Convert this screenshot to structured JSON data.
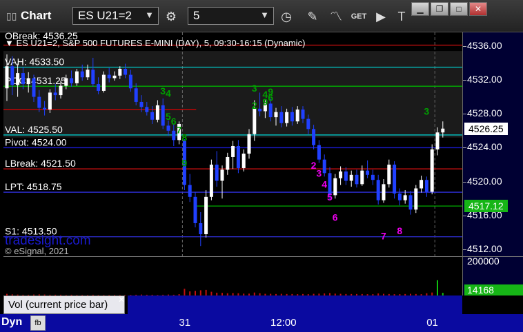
{
  "window": {
    "title": "Chart",
    "symbol": "ES U21=2",
    "interval": "5",
    "controls": [
      "minimize",
      "restore",
      "maximize",
      "close"
    ]
  },
  "toolbar_icons": [
    "gear-icon",
    "clock-icon",
    "pencil-icon",
    "line-tool-icon",
    "get-icon",
    "play-icon",
    "text-tool-icon"
  ],
  "header": {
    "top_label": "OBreak: 4536.25",
    "description": "ES U21=2, S&P 500 FUTURES E-MINI (DAY), 5, 09:30-16:15 (Dynamic)"
  },
  "levels": [
    {
      "name": "VAH",
      "label": "VAH: 4533.50",
      "value": 4533.5,
      "color": "#00c8c8",
      "x_from": 0
    },
    {
      "name": "POC",
      "label": "POC: 4531.25",
      "value": 4531.25,
      "color": "#00b000",
      "x_from": 0
    },
    {
      "name": "Red line",
      "label": "",
      "value": 4528.5,
      "color": "#e00000",
      "x_from": 0,
      "x_to": 0.42
    },
    {
      "name": "VAL",
      "label": "VAL: 4525.50",
      "value": 4525.5,
      "color": "#00c8c8",
      "x_from": 0
    },
    {
      "name": "Pivot",
      "label": "Pivot: 4524.00",
      "value": 4524.0,
      "color": "#1a1acc",
      "x_from": 0
    },
    {
      "name": "LBreak",
      "label": "LBreak: 4521.50",
      "value": 4521.5,
      "color": "#d01010",
      "x_from": 0
    },
    {
      "name": "LPT",
      "label": "LPT: 4518.75",
      "value": 4518.75,
      "color": "#3030e0",
      "x_from": 0
    },
    {
      "name": "Green low",
      "label": "",
      "value": 4517.12,
      "color": "#00b000",
      "x_from": 0.42
    },
    {
      "name": "S1",
      "label": "S1: 4513.50",
      "value": 4513.5,
      "color": "#2a2ac0",
      "x_from": 0
    },
    {
      "name": "Upper red",
      "label": "",
      "value": 4536.1,
      "color": "#d01010",
      "x_from": 0
    }
  ],
  "watermarks": {
    "brand": "tradesight.com",
    "copyright": "© eSignal, 2021"
  },
  "chart_data": {
    "type": "candlestick",
    "ylim": [
      4511.2,
      4537.6
    ],
    "yticks": [
      4512,
      4516,
      4520,
      4524,
      4528,
      4532,
      4536
    ],
    "ytick_labels": [
      "4512.00",
      "4516.00",
      "4520.00",
      "4524.00",
      "4528.00",
      "4532.00",
      "4536.00"
    ],
    "last_price": "4526.25",
    "lpt_price": "4517.12",
    "x_labels": [
      {
        "text": "31",
        "index": 33
      },
      {
        "text": "12:00",
        "index": 50
      },
      {
        "text": "01",
        "index": 79
      }
    ],
    "candles": [
      {
        "o": 4531.0,
        "h": 4535.0,
        "l": 4529.5,
        "c": 4533.6
      },
      {
        "o": 4533.6,
        "h": 4534.8,
        "l": 4530.2,
        "c": 4531.4
      },
      {
        "o": 4531.4,
        "h": 4533.9,
        "l": 4530.0,
        "c": 4532.8
      },
      {
        "o": 4532.8,
        "h": 4533.5,
        "l": 4530.9,
        "c": 4531.5
      },
      {
        "o": 4531.5,
        "h": 4532.9,
        "l": 4530.5,
        "c": 4532.2
      },
      {
        "o": 4532.2,
        "h": 4532.6,
        "l": 4529.4,
        "c": 4530.0
      },
      {
        "o": 4530.0,
        "h": 4530.8,
        "l": 4528.2,
        "c": 4528.7
      },
      {
        "o": 4528.7,
        "h": 4529.5,
        "l": 4527.8,
        "c": 4528.5
      },
      {
        "o": 4528.5,
        "h": 4530.9,
        "l": 4528.1,
        "c": 4530.5
      },
      {
        "o": 4530.5,
        "h": 4531.5,
        "l": 4529.6,
        "c": 4530.2
      },
      {
        "o": 4530.2,
        "h": 4531.9,
        "l": 4529.8,
        "c": 4531.3
      },
      {
        "o": 4531.3,
        "h": 4532.6,
        "l": 4530.9,
        "c": 4532.2
      },
      {
        "o": 4532.2,
        "h": 4533.1,
        "l": 4531.2,
        "c": 4531.6
      },
      {
        "o": 4531.6,
        "h": 4533.3,
        "l": 4531.3,
        "c": 4533.0
      },
      {
        "o": 4533.0,
        "h": 4533.8,
        "l": 4531.9,
        "c": 4532.3
      },
      {
        "o": 4532.3,
        "h": 4533.8,
        "l": 4532.0,
        "c": 4533.2
      },
      {
        "o": 4533.2,
        "h": 4534.6,
        "l": 4531.2,
        "c": 4531.5
      },
      {
        "o": 4531.5,
        "h": 4532.3,
        "l": 4530.3,
        "c": 4530.7
      },
      {
        "o": 4530.7,
        "h": 4533.0,
        "l": 4530.5,
        "c": 4532.6
      },
      {
        "o": 4532.6,
        "h": 4533.4,
        "l": 4531.7,
        "c": 4532.2
      },
      {
        "o": 4532.2,
        "h": 4533.0,
        "l": 4531.9,
        "c": 4532.5
      },
      {
        "o": 4532.5,
        "h": 4533.6,
        "l": 4532.1,
        "c": 4533.3
      },
      {
        "o": 4533.3,
        "h": 4533.9,
        "l": 4532.2,
        "c": 4532.6
      },
      {
        "o": 4532.6,
        "h": 4533.2,
        "l": 4530.6,
        "c": 4531.0
      },
      {
        "o": 4531.0,
        "h": 4531.6,
        "l": 4529.0,
        "c": 4529.4
      },
      {
        "o": 4529.4,
        "h": 4530.2,
        "l": 4528.2,
        "c": 4528.8
      },
      {
        "o": 4528.8,
        "h": 4529.4,
        "l": 4527.8,
        "c": 4528.2
      },
      {
        "o": 4528.2,
        "h": 4528.9,
        "l": 4526.8,
        "c": 4527.3
      },
      {
        "o": 4527.3,
        "h": 4529.6,
        "l": 4527.0,
        "c": 4529.0
      },
      {
        "o": 4529.0,
        "h": 4529.8,
        "l": 4526.2,
        "c": 4526.6
      },
      {
        "o": 4526.6,
        "h": 4527.2,
        "l": 4525.4,
        "c": 4526.0
      },
      {
        "o": 4526.0,
        "h": 4526.8,
        "l": 4524.2,
        "c": 4524.9
      },
      {
        "o": 4524.9,
        "h": 4527.1,
        "l": 4524.4,
        "c": 4526.8
      },
      {
        "o": 4524.8,
        "h": 4525.0,
        "l": 4519.0,
        "c": 4519.6
      },
      {
        "o": 4519.6,
        "h": 4520.9,
        "l": 4517.6,
        "c": 4518.2
      },
      {
        "o": 4518.2,
        "h": 4518.8,
        "l": 4514.6,
        "c": 4515.1
      },
      {
        "o": 4515.1,
        "h": 4516.4,
        "l": 4512.4,
        "c": 4513.8
      },
      {
        "o": 4513.8,
        "h": 4519.0,
        "l": 4513.4,
        "c": 4518.2
      },
      {
        "o": 4518.2,
        "h": 4522.6,
        "l": 4517.8,
        "c": 4522.0
      },
      {
        "o": 4522.0,
        "h": 4523.6,
        "l": 4519.4,
        "c": 4520.1
      },
      {
        "o": 4520.1,
        "h": 4521.9,
        "l": 4518.0,
        "c": 4521.4
      },
      {
        "o": 4521.4,
        "h": 4523.4,
        "l": 4520.8,
        "c": 4522.9
      },
      {
        "o": 4522.9,
        "h": 4524.8,
        "l": 4521.5,
        "c": 4524.2
      },
      {
        "o": 4524.2,
        "h": 4524.9,
        "l": 4521.0,
        "c": 4521.6
      },
      {
        "o": 4521.6,
        "h": 4523.8,
        "l": 4521.2,
        "c": 4523.3
      },
      {
        "o": 4523.3,
        "h": 4526.2,
        "l": 4522.7,
        "c": 4525.6
      },
      {
        "o": 4525.6,
        "h": 4529.6,
        "l": 4524.8,
        "c": 4528.6
      },
      {
        "o": 4528.6,
        "h": 4530.5,
        "l": 4527.7,
        "c": 4528.3
      },
      {
        "o": 4528.3,
        "h": 4529.6,
        "l": 4527.5,
        "c": 4529.2
      },
      {
        "o": 4529.2,
        "h": 4529.8,
        "l": 4527.1,
        "c": 4527.6
      },
      {
        "o": 4527.6,
        "h": 4528.7,
        "l": 4526.6,
        "c": 4528.2
      },
      {
        "o": 4528.2,
        "h": 4528.9,
        "l": 4526.4,
        "c": 4526.9
      },
      {
        "o": 4526.9,
        "h": 4528.6,
        "l": 4526.5,
        "c": 4528.2
      },
      {
        "o": 4528.2,
        "h": 4528.8,
        "l": 4526.6,
        "c": 4527.1
      },
      {
        "o": 4527.1,
        "h": 4528.9,
        "l": 4526.8,
        "c": 4528.5
      },
      {
        "o": 4528.5,
        "h": 4528.9,
        "l": 4526.9,
        "c": 4527.4
      },
      {
        "o": 4527.4,
        "h": 4527.9,
        "l": 4525.6,
        "c": 4526.2
      },
      {
        "o": 4526.2,
        "h": 4526.7,
        "l": 4523.8,
        "c": 4524.3
      },
      {
        "o": 4524.3,
        "h": 4524.9,
        "l": 4522.2,
        "c": 4522.6
      },
      {
        "o": 4522.6,
        "h": 4523.2,
        "l": 4520.6,
        "c": 4521.0
      },
      {
        "o": 4521.0,
        "h": 4521.7,
        "l": 4517.8,
        "c": 4518.4
      },
      {
        "o": 4518.4,
        "h": 4520.9,
        "l": 4518.0,
        "c": 4520.4
      },
      {
        "o": 4520.4,
        "h": 4521.8,
        "l": 4519.6,
        "c": 4521.2
      },
      {
        "o": 4521.2,
        "h": 4521.7,
        "l": 4519.6,
        "c": 4520.1
      },
      {
        "o": 4520.1,
        "h": 4521.3,
        "l": 4519.4,
        "c": 4520.8
      },
      {
        "o": 4520.8,
        "h": 4521.4,
        "l": 4519.3,
        "c": 4519.7
      },
      {
        "o": 4519.7,
        "h": 4521.9,
        "l": 4519.5,
        "c": 4521.3
      },
      {
        "o": 4521.3,
        "h": 4522.5,
        "l": 4520.4,
        "c": 4520.8
      },
      {
        "o": 4520.8,
        "h": 4521.4,
        "l": 4519.6,
        "c": 4520.2
      },
      {
        "o": 4520.2,
        "h": 4520.8,
        "l": 4517.3,
        "c": 4517.8
      },
      {
        "o": 4517.8,
        "h": 4520.3,
        "l": 4517.5,
        "c": 4519.7
      },
      {
        "o": 4519.7,
        "h": 4522.6,
        "l": 4519.3,
        "c": 4522.0
      },
      {
        "o": 4522.0,
        "h": 4522.4,
        "l": 4518.0,
        "c": 4518.6
      },
      {
        "o": 4518.6,
        "h": 4519.2,
        "l": 4517.2,
        "c": 4517.8
      },
      {
        "o": 4517.8,
        "h": 4519.0,
        "l": 4517.4,
        "c": 4518.4
      },
      {
        "o": 4518.4,
        "h": 4518.9,
        "l": 4516.1,
        "c": 4516.7
      },
      {
        "o": 4516.7,
        "h": 4519.6,
        "l": 4516.3,
        "c": 4519.2
      },
      {
        "o": 4519.2,
        "h": 4520.7,
        "l": 4518.7,
        "c": 4520.2
      },
      {
        "o": 4520.2,
        "h": 4520.6,
        "l": 4518.2,
        "c": 4518.8
      },
      {
        "o": 4518.8,
        "h": 4524.4,
        "l": 4518.5,
        "c": 4523.8
      },
      {
        "o": 4523.8,
        "h": 4526.4,
        "l": 4523.1,
        "c": 4525.8
      },
      {
        "o": 4525.8,
        "h": 4527.1,
        "l": 4525.2,
        "c": 4526.25
      }
    ],
    "volume": {
      "max_label": "200000",
      "current_label": "14168",
      "ylim": [
        0,
        200000
      ],
      "values": [
        9000,
        6000,
        5000,
        4000,
        4000,
        5000,
        6000,
        5000,
        4000,
        4000,
        4000,
        3000,
        4000,
        3000,
        3000,
        3000,
        4000,
        3000,
        3000,
        3000,
        3000,
        3000,
        3000,
        3000,
        4000,
        5000,
        4000,
        4000,
        3000,
        4000,
        5000,
        4000,
        7000,
        36000,
        22000,
        25000,
        28000,
        30000,
        20000,
        15000,
        14000,
        12000,
        13000,
        12000,
        10000,
        10000,
        16000,
        12000,
        9000,
        9000,
        8000,
        9000,
        8000,
        8000,
        7000,
        8000,
        7000,
        9000,
        10000,
        11000,
        13000,
        10000,
        9000,
        8000,
        8000,
        8000,
        8000,
        7000,
        7000,
        11000,
        9000,
        8000,
        7000,
        7000,
        8000,
        9000,
        8000,
        7000,
        12000,
        16000,
        82000,
        14168
      ]
    },
    "annotations": [
      {
        "text": "3",
        "i": 29,
        "y": 4530.3,
        "color": "#00a000"
      },
      {
        "text": "4",
        "i": 30,
        "y": 4530.0,
        "color": "#00a000"
      },
      {
        "text": "5",
        "i": 30,
        "y": 4527.3,
        "color": "#00a000"
      },
      {
        "text": "6",
        "i": 31,
        "y": 4526.7,
        "color": "#00a000"
      },
      {
        "text": "7",
        "i": 32,
        "y": 4525.7,
        "color": "#00a000"
      },
      {
        "text": "8",
        "i": 33,
        "y": 4524.8,
        "color": "#00a000"
      },
      {
        "text": "9",
        "i": 33,
        "y": 4521.8,
        "color": "#00a000"
      },
      {
        "text": "3",
        "i": 46,
        "y": 4530.6,
        "color": "#00a000"
      },
      {
        "text": "2",
        "i": 46,
        "y": 4528.6,
        "color": "#00a000"
      },
      {
        "text": "4",
        "i": 48,
        "y": 4529.9,
        "color": "#00a000"
      },
      {
        "text": "9",
        "i": 48,
        "y": 4529.0,
        "color": "#00a000"
      },
      {
        "text": "6",
        "i": 49,
        "y": 4529.5,
        "color": "#00a000"
      },
      {
        "text": "9",
        "i": 49,
        "y": 4530.2,
        "color": "#00a000"
      },
      {
        "text": "3",
        "i": 78,
        "y": 4527.9,
        "color": "#00a000"
      },
      {
        "text": "2",
        "i": 57,
        "y": 4521.5,
        "color": "#ee00ee"
      },
      {
        "text": "3",
        "i": 58,
        "y": 4520.6,
        "color": "#ee00ee"
      },
      {
        "text": "4",
        "i": 59,
        "y": 4519.3,
        "color": "#ee00ee"
      },
      {
        "text": "5",
        "i": 60,
        "y": 4517.8,
        "color": "#ee00ee"
      },
      {
        "text": "6",
        "i": 61,
        "y": 4515.4,
        "color": "#ee00ee"
      },
      {
        "text": "7",
        "i": 70,
        "y": 4513.2,
        "color": "#ee00ee"
      },
      {
        "text": "8",
        "i": 73,
        "y": 4513.8,
        "color": "#ee00ee"
      }
    ]
  },
  "volume_panel": {
    "legend": "Vol (current price bar)"
  },
  "bottom_bar": {
    "mode": "Dyn"
  }
}
